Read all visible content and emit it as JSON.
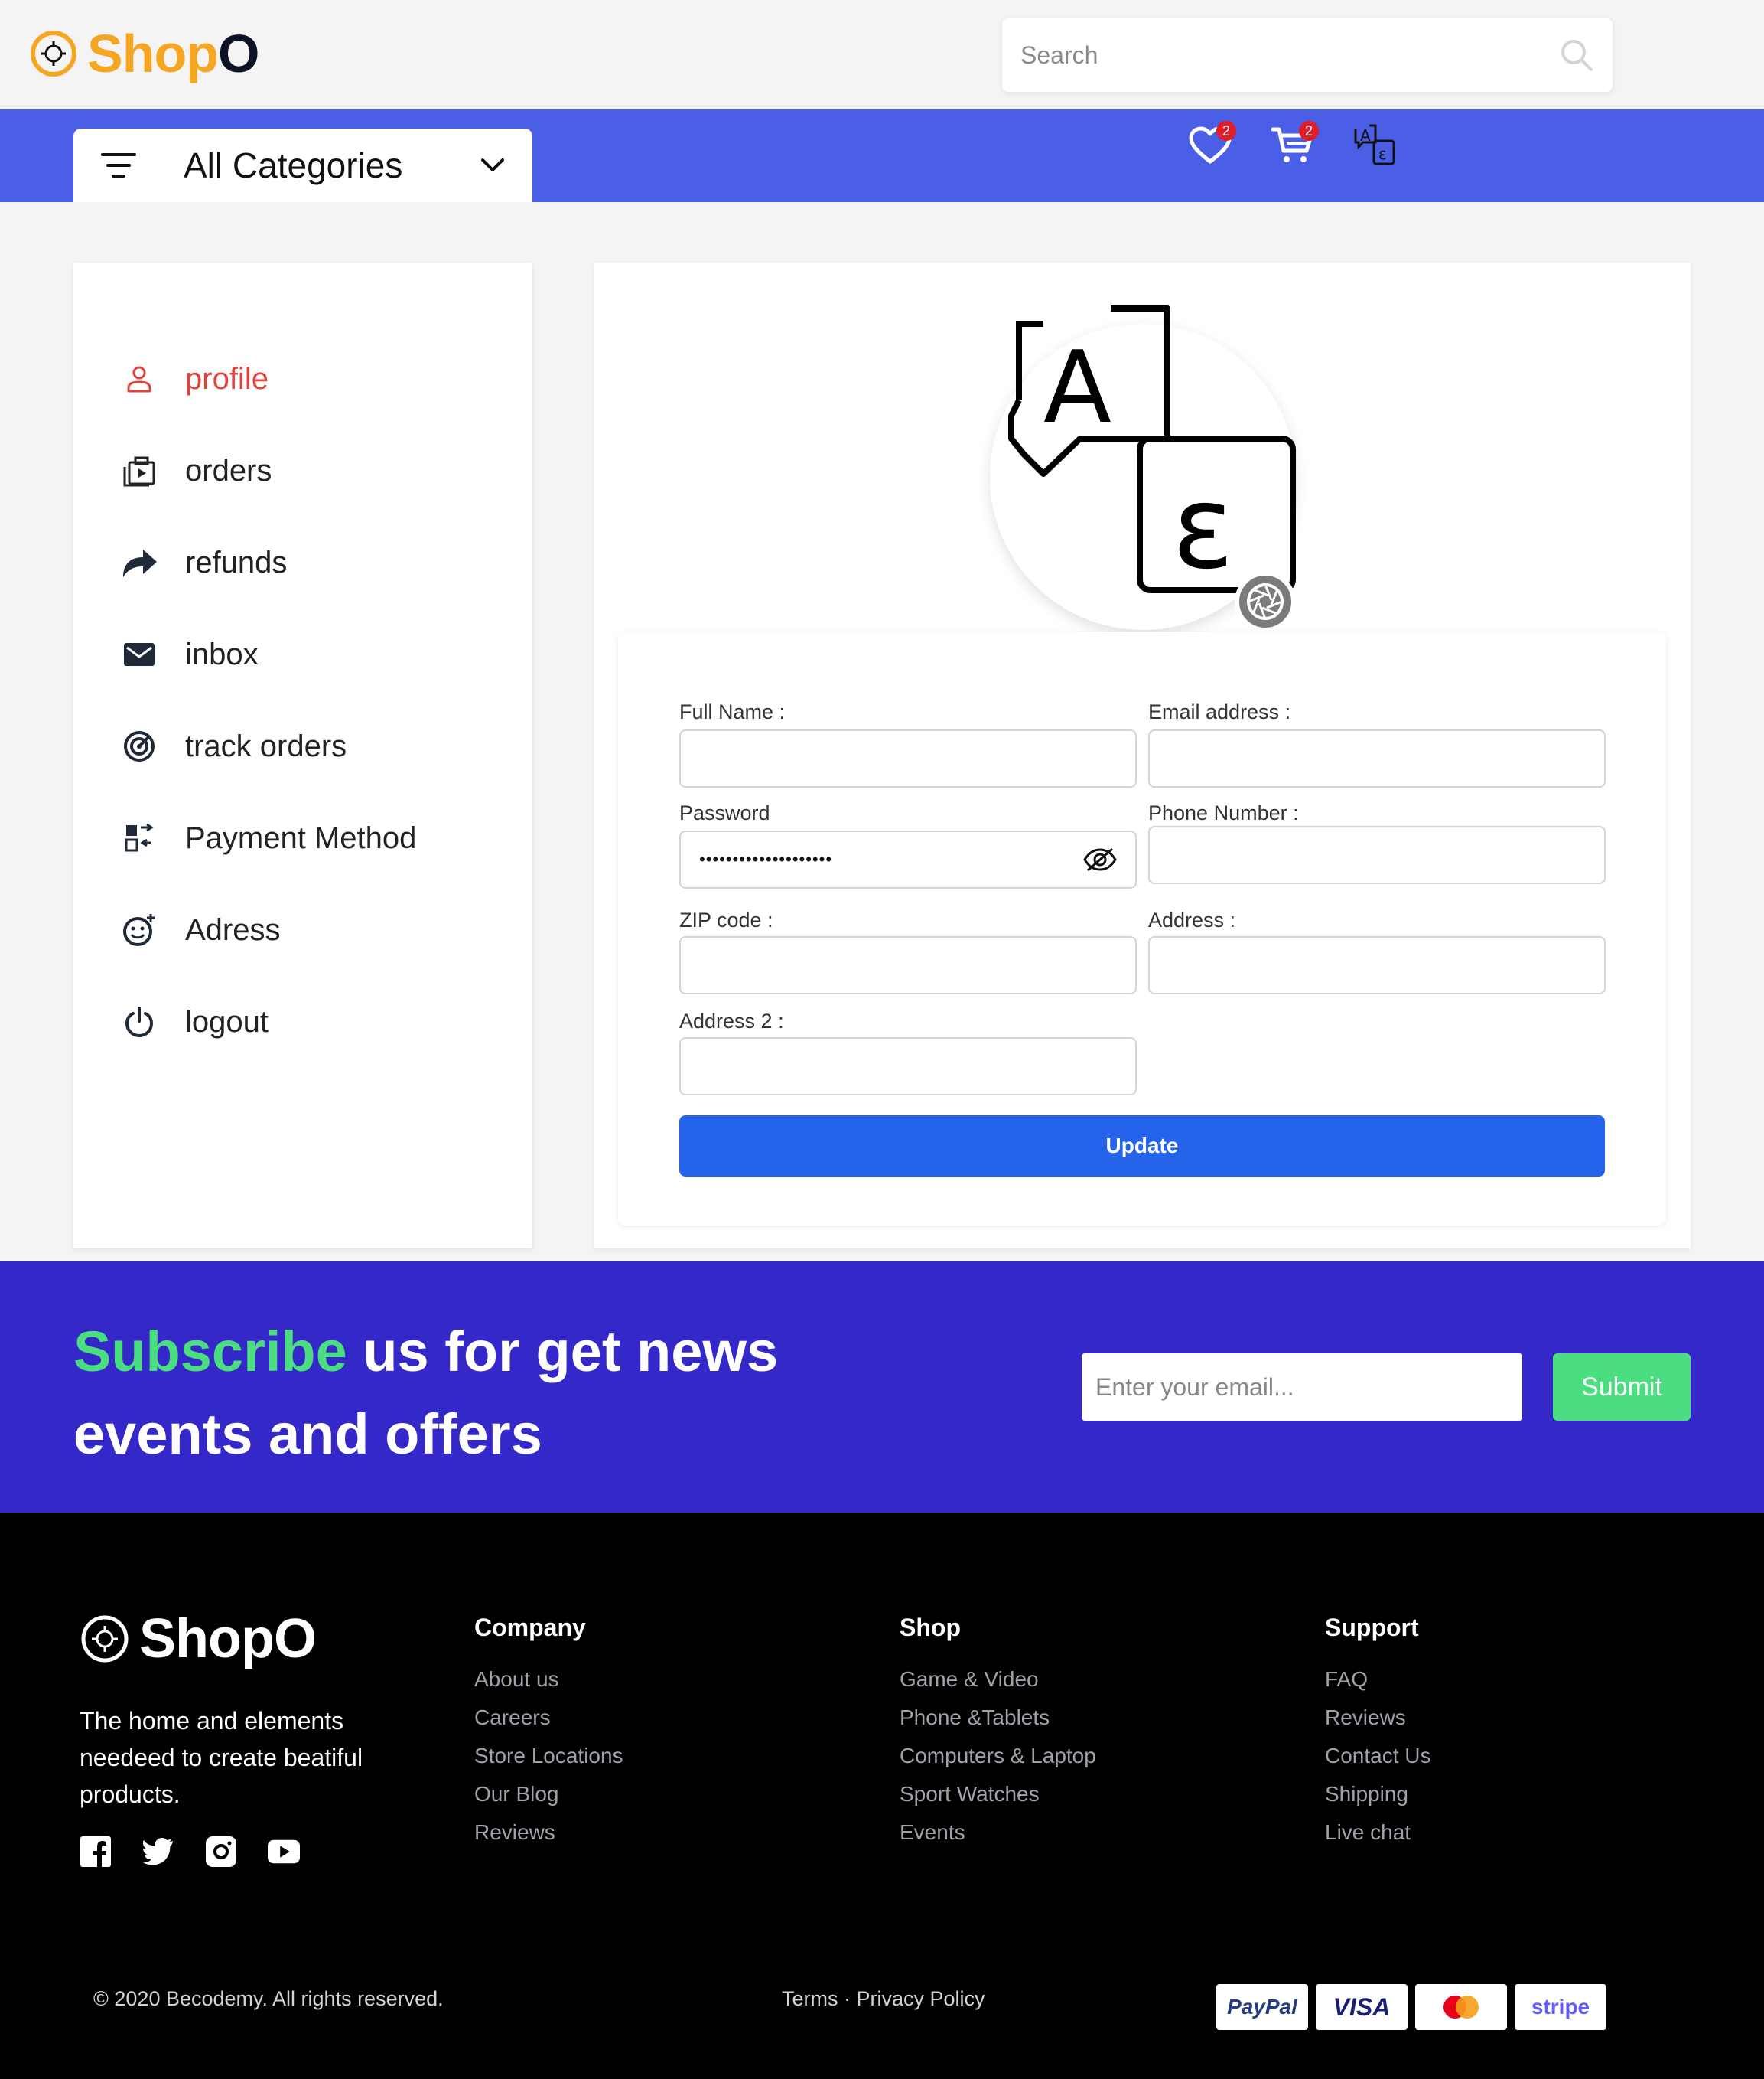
{
  "header": {
    "logo_text_colored": "Shop",
    "logo_text_dark": "O",
    "search_placeholder": "Search",
    "categories_label": "All Categories",
    "wishlist_count": "2",
    "cart_count": "2"
  },
  "sidebar": {
    "items": [
      {
        "label": "profile",
        "icon": "user-icon",
        "active": true
      },
      {
        "label": "orders",
        "icon": "orders-icon"
      },
      {
        "label": "refunds",
        "icon": "share-arrow-icon"
      },
      {
        "label": "inbox",
        "icon": "mail-icon"
      },
      {
        "label": "track orders",
        "icon": "target-icon"
      },
      {
        "label": "Payment Method",
        "icon": "payment-icon"
      },
      {
        "label": "Adress",
        "icon": "smile-icon"
      },
      {
        "label": "logout",
        "icon": "power-icon"
      }
    ]
  },
  "profile_form": {
    "full_name_label": "Full Name :",
    "email_label": "Email address :",
    "password_label": "Password",
    "password_value": "••••••••••••••••••••",
    "phone_label": "Phone Number :",
    "zip_label": "ZIP code :",
    "address_label": "Address :",
    "address2_label": "Address 2 :",
    "update_label": "Update"
  },
  "subscribe": {
    "highlight": "Subscribe",
    "title_rest": " us for get news events and offers",
    "email_placeholder": "Enter your email...",
    "submit_label": "Submit"
  },
  "footer": {
    "logo_text": "ShopO",
    "description": "The home and elements needeed to create beatiful products.",
    "columns": [
      {
        "title": "Company",
        "links": [
          "About us",
          "Careers",
          "Store Locations",
          "Our Blog",
          "Reviews"
        ]
      },
      {
        "title": "Shop",
        "links": [
          "Game & Video",
          "Phone &Tablets",
          "Computers & Laptop",
          "Sport Watches",
          "Events"
        ]
      },
      {
        "title": "Support",
        "links": [
          "FAQ",
          "Reviews",
          "Contact Us",
          "Shipping",
          "Live chat"
        ]
      }
    ],
    "copyright": "© 2020 Becodemy. All rights reserved.",
    "legal": "Terms · Privacy Policy",
    "payments": [
      "PayPal",
      "VISA",
      "Mastercard",
      "stripe"
    ]
  },
  "colors": {
    "brand_orange": "#f5a623",
    "nav_blue": "#4a5fe6",
    "subscribe_bg": "#3528c8",
    "accent_green": "#4ade80",
    "button_blue": "#2563eb",
    "active_red": "#e0433b"
  }
}
